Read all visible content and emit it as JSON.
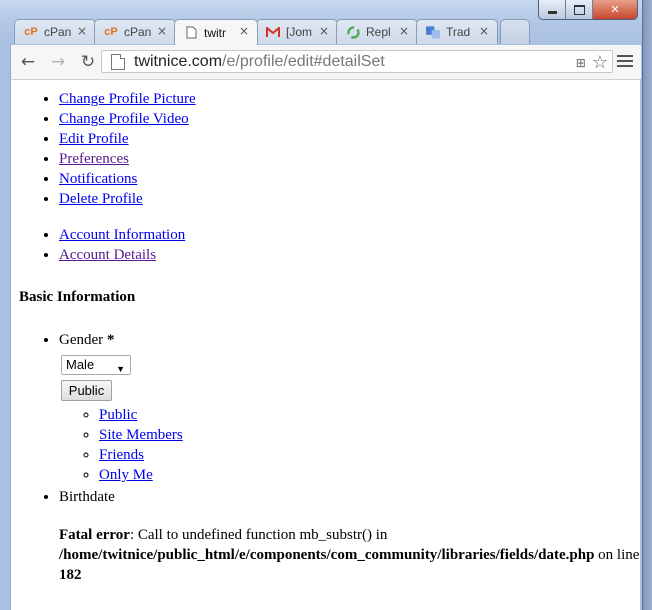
{
  "browser": {
    "tabs": [
      {
        "label": "cPan",
        "icon": "cpanel-icon"
      },
      {
        "label": "cPan",
        "icon": "cpanel-icon"
      },
      {
        "label": "twitr",
        "icon": "page-icon",
        "active": true
      },
      {
        "label": "[Jom",
        "icon": "gmail-icon"
      },
      {
        "label": "Repl",
        "icon": "spinner-icon"
      },
      {
        "label": "Trad",
        "icon": "translate-icon"
      }
    ],
    "tab_close_glyph": "×",
    "url_host": "twitnice.com",
    "url_path": "/e/profile/edit#detailSet"
  },
  "page": {
    "menu1": [
      "Change Profile Picture",
      "Change Profile Video",
      "Edit Profile",
      "Preferences",
      "Notifications",
      "Delete Profile"
    ],
    "menu2": [
      "Account Information",
      "Account Details"
    ],
    "section_title": "Basic Information",
    "gender_label": "Gender",
    "required_mark": "*",
    "gender_value": "Male",
    "privacy_button": "Public",
    "privacy_options": [
      "Public",
      "Site Members",
      "Friends",
      "Only Me"
    ],
    "birthdate_label": "Birthdate",
    "error": {
      "title": "Fatal error",
      "message": ": Call to undefined function mb_substr() in",
      "path": "/home/twitnice/public_html/e/components/com_community/libraries/fields/date.php",
      "on_line": " on line ",
      "line": "182"
    }
  }
}
